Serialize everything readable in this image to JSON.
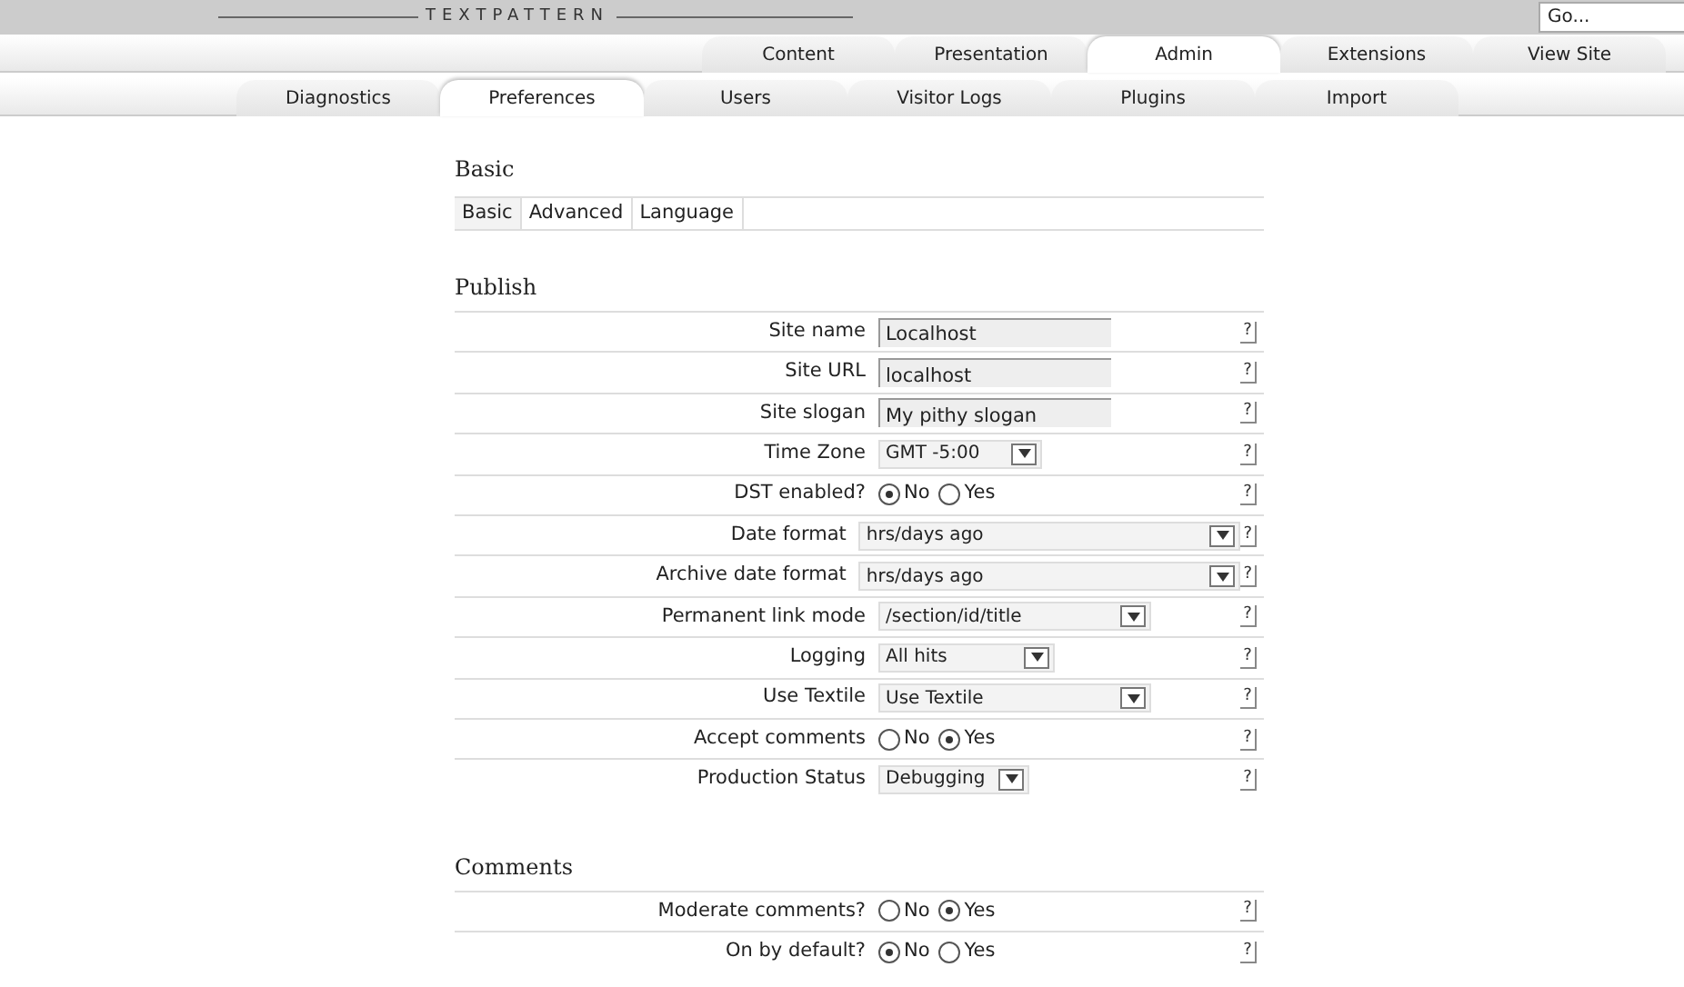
{
  "header": {
    "logo": "TEXTPATTERN",
    "jump": {
      "value": "Go..."
    }
  },
  "main_tabs": [
    {
      "label": "Content",
      "selected": false
    },
    {
      "label": "Presentation",
      "selected": false
    },
    {
      "label": "Admin",
      "selected": true
    },
    {
      "label": "Extensions",
      "selected": false
    },
    {
      "label": "View Site",
      "selected": false
    }
  ],
  "sub_tabs": [
    {
      "label": "Diagnostics",
      "selected": false
    },
    {
      "label": "Preferences",
      "selected": true
    },
    {
      "label": "Users",
      "selected": false
    },
    {
      "label": "Visitor Logs",
      "selected": false
    },
    {
      "label": "Plugins",
      "selected": false
    },
    {
      "label": "Import",
      "selected": false
    }
  ],
  "page_title": "Basic",
  "pref_tabs": [
    {
      "label": "Basic",
      "selected": true
    },
    {
      "label": "Advanced",
      "selected": false
    },
    {
      "label": "Language",
      "selected": false
    }
  ],
  "sections": [
    {
      "title": "Publish",
      "rows": [
        {
          "kind": "text",
          "label": "Site name",
          "value": "Localhost",
          "help": "?"
        },
        {
          "kind": "text",
          "label": "Site URL",
          "value": "localhost",
          "help": "?"
        },
        {
          "kind": "text",
          "label": "Site slogan",
          "value": "My pithy slogan",
          "help": "?"
        },
        {
          "kind": "select",
          "label": "Time Zone",
          "value": "GMT -5:00",
          "help": "?"
        },
        {
          "kind": "radio",
          "label": "DST enabled?",
          "options": [
            {
              "label": "No",
              "selected": true
            },
            {
              "label": "Yes",
              "selected": false
            }
          ],
          "help": "?"
        },
        {
          "kind": "select",
          "label": "Date format",
          "value": "hrs/days ago",
          "help": "?"
        },
        {
          "kind": "select",
          "label": "Archive date format",
          "value": "hrs/days ago",
          "help": "?"
        },
        {
          "kind": "select",
          "label": "Permanent link mode",
          "value": "/section/id/title",
          "help": "?"
        },
        {
          "kind": "select",
          "label": "Logging",
          "value": "All hits",
          "help": "?"
        },
        {
          "kind": "select",
          "label": "Use Textile",
          "value": "Use Textile",
          "help": "?"
        },
        {
          "kind": "radio",
          "label": "Accept comments",
          "options": [
            {
              "label": "No",
              "selected": false
            },
            {
              "label": "Yes",
              "selected": true
            }
          ],
          "help": "?"
        },
        {
          "kind": "select",
          "label": "Production Status",
          "value": "Debugging",
          "help": "?"
        }
      ]
    },
    {
      "title": "Comments",
      "rows": [
        {
          "kind": "radio",
          "label": "Moderate comments?",
          "options": [
            {
              "label": "No",
              "selected": false
            },
            {
              "label": "Yes",
              "selected": true
            }
          ],
          "help": "?"
        },
        {
          "kind": "radio",
          "label": "On by default?",
          "options": [
            {
              "label": "No",
              "selected": true
            },
            {
              "label": "Yes",
              "selected": false
            }
          ],
          "help": "?"
        }
      ]
    }
  ]
}
